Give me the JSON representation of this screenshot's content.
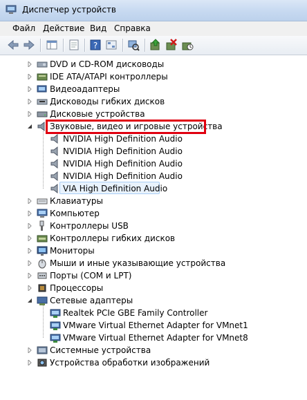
{
  "window": {
    "title": "Диспетчер устройств"
  },
  "menu": {
    "file": "Файл",
    "action": "Действие",
    "view": "Вид",
    "help": "Справка"
  },
  "toolbar": {
    "back": "back-arrow-icon",
    "forward": "forward-arrow-icon",
    "tree_view": "console-tree-icon",
    "properties": "properties-icon",
    "help": "help-icon",
    "devices_view": "device-view-icon",
    "update_driver": "update-driver-icon",
    "uninstall": "uninstall-icon",
    "scan": "scan-hardware-icon"
  },
  "tree": {
    "items": [
      {
        "label": "DVD и CD-ROM дисководы",
        "icon": "dvd-drive-icon"
      },
      {
        "label": "IDE ATA/ATAPI контроллеры",
        "icon": "ide-controller-icon"
      },
      {
        "label": "Видеоадаптеры",
        "icon": "display-adapter-icon"
      },
      {
        "label": "Дисководы гибких дисков",
        "icon": "floppy-drive-icon"
      },
      {
        "label": "Дисковые устройства",
        "icon": "disk-drive-icon"
      },
      {
        "label": "Звуковые, видео и игровые устройства",
        "icon": "sound-icon"
      },
      {
        "label": "NVIDIA High Definition Audio",
        "icon": "speaker-icon"
      },
      {
        "label": "NVIDIA High Definition Audio",
        "icon": "speaker-icon"
      },
      {
        "label": "NVIDIA High Definition Audio",
        "icon": "speaker-icon"
      },
      {
        "label": "NVIDIA High Definition Audio",
        "icon": "speaker-icon"
      },
      {
        "label": "VIA High Definition Audio",
        "icon": "speaker-icon"
      },
      {
        "label": "Клавиатуры",
        "icon": "keyboard-icon"
      },
      {
        "label": "Компьютер",
        "icon": "computer-icon"
      },
      {
        "label": "Контроллеры USB",
        "icon": "usb-icon"
      },
      {
        "label": "Контроллеры гибких дисков",
        "icon": "floppy-controller-icon"
      },
      {
        "label": "Мониторы",
        "icon": "monitor-icon"
      },
      {
        "label": "Мыши и иные указывающие устройства",
        "icon": "mouse-icon"
      },
      {
        "label": "Порты (COM и LPT)",
        "icon": "port-icon"
      },
      {
        "label": "Процессоры",
        "icon": "processor-icon"
      },
      {
        "label": "Сетевые адаптеры",
        "icon": "network-adapter-icon"
      },
      {
        "label": "Realtek PCIe GBE Family Controller",
        "icon": "network-card-icon"
      },
      {
        "label": "VMware Virtual Ethernet Adapter for VMnet1",
        "icon": "network-card-icon"
      },
      {
        "label": "VMware Virtual Ethernet Adapter for VMnet8",
        "icon": "network-card-icon"
      },
      {
        "label": "Системные устройства",
        "icon": "system-devices-icon"
      },
      {
        "label": "Устройства обработки изображений",
        "icon": "imaging-devices-icon"
      }
    ]
  },
  "colors": {
    "highlight": "#e0000f",
    "selection": "#e8f2fd"
  }
}
